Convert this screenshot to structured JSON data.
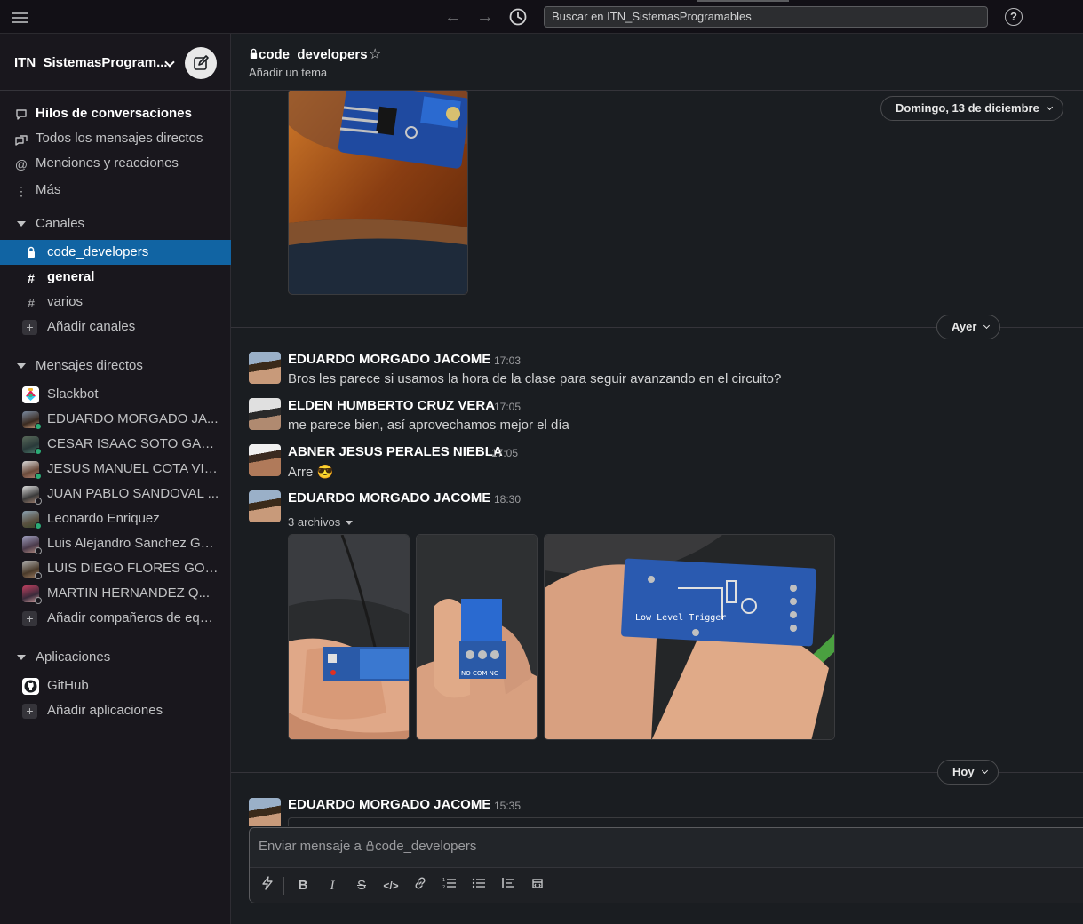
{
  "topbar": {
    "search_text": "Buscar en ITN_SistemasProgramables",
    "help_label": "?"
  },
  "workspace": {
    "name": "ITN_SistemasProgram..."
  },
  "sidebar": {
    "nav": [
      {
        "label": "Hilos de conversaciones",
        "icon": "threads-icon"
      },
      {
        "label": "Todos los mensajes directos",
        "icon": "dm-icon"
      },
      {
        "label": "Menciones y reacciones",
        "icon": "mentions-icon"
      },
      {
        "label": "Más",
        "icon": "more-icon"
      }
    ],
    "channels_header": "Canales",
    "channels": [
      {
        "name": "code_developers",
        "icon": "lock-icon"
      },
      {
        "name": "general",
        "icon": "hash-icon"
      },
      {
        "name": "varios",
        "icon": "hash-icon"
      }
    ],
    "add_channels": "Añadir canales",
    "dm_header": "Mensajes directos",
    "dms": [
      {
        "name": "Slackbot"
      },
      {
        "name": "EDUARDO MORGADO JA..."
      },
      {
        "name": "CESAR ISAAC SOTO GAR..."
      },
      {
        "name": "JESUS MANUEL COTA VIL..."
      },
      {
        "name": "JUAN PABLO SANDOVAL ..."
      },
      {
        "name": "Leonardo Enriquez"
      },
      {
        "name": "Luis Alejandro Sanchez Gall..."
      },
      {
        "name": "LUIS DIEGO FLORES GON..."
      },
      {
        "name": "MARTIN HERNANDEZ Q..."
      }
    ],
    "add_teammates": "Añadir compañeros de equi...",
    "apps_header": "Aplicaciones",
    "apps": [
      {
        "name": "GitHub"
      }
    ],
    "add_apps": "Añadir aplicaciones"
  },
  "channel": {
    "name": "code_developers",
    "topic": "Añadir un tema"
  },
  "dates": {
    "sunday": "Domingo, 13 de diciembre",
    "yesterday": "Ayer",
    "today": "Hoy"
  },
  "messages": [
    {
      "author": "EDUARDO MORGADO JACOME",
      "time": "17:03",
      "text": "Bros les parece si usamos la hora de la clase para seguir avanzando en el circuito?"
    },
    {
      "author": "ELDEN HUMBERTO CRUZ VERA",
      "time": "17:05",
      "text": "me parece bien, así aprovechamos mejor el día"
    },
    {
      "author": "ABNER JESUS PERALES NIEBLA",
      "time": "17:05",
      "text": "Arre",
      "emoji": "😎"
    },
    {
      "author": "EDUARDO MORGADO JACOME",
      "time": "18:30",
      "files_label": "3 archivos"
    },
    {
      "author": "EDUARDO MORGADO JACOME",
      "time": "15:35"
    }
  ],
  "image_labels": {
    "relay_back_text": "Low Level Trigger",
    "terminal_text": "NO COM NC"
  },
  "composer": {
    "placeholder": "Enviar mensaje a ",
    "channel": "code_developers"
  },
  "colors": {
    "accent": "#1164a3",
    "online": "#2bac76",
    "background": "#1a1d21",
    "sidebar": "#19171d"
  }
}
